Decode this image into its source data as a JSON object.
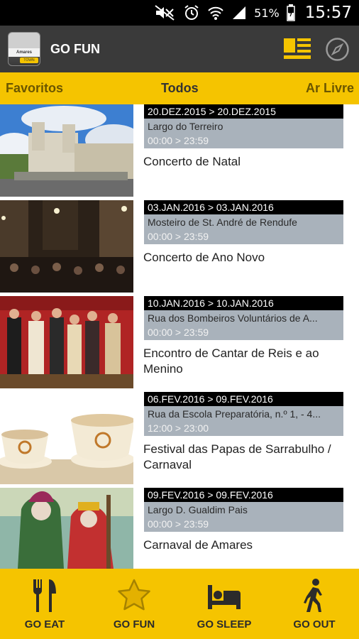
{
  "status_bar": {
    "battery": "51%",
    "time": "15:57"
  },
  "app_bar": {
    "title": "GO FUN",
    "logo_text": "Amares",
    "logo_badge": "TOWN"
  },
  "tabs": {
    "favorites": "Favoritos",
    "all": "Todos",
    "outdoor": "Ar Livre"
  },
  "events": [
    {
      "date": "20.DEZ.2015 > 20.DEZ.2015",
      "location": "Largo do Terreiro",
      "time": "00:00 > 23:59",
      "title": "Concerto de Natal"
    },
    {
      "date": "03.JAN.2016 > 03.JAN.2016",
      "location": "Mosteiro de St. André de Rendufe",
      "time": "00:00 > 23:59",
      "title": "Concerto de Ano Novo"
    },
    {
      "date": "10.JAN.2016 > 10.JAN.2016",
      "location": "Rua dos Bombeiros Voluntários de A...",
      "time": "00:00 > 23:59",
      "title": "Encontro de Cantar de Reis e ao Menino"
    },
    {
      "date": "06.FEV.2016 > 09.FEV.2016",
      "location": "Rua da Escola Preparatória, n.º 1, - 4...",
      "time": "12:00 > 23:00",
      "title": "Festival das Papas de Sarrabulho / Carnaval"
    },
    {
      "date": "09.FEV.2016 > 09.FEV.2016",
      "location": "Largo D. Gualdim Pais",
      "time": "00:00 > 23:59",
      "title": "Carnaval de Amares"
    }
  ],
  "bottom_nav": {
    "eat": "GO EAT",
    "fun": "GO FUN",
    "sleep": "GO SLEEP",
    "out": "GO OUT"
  },
  "colors": {
    "accent": "#f5c400",
    "app_bar": "#3a3a3a",
    "date_bar": "#000000",
    "location_box": "#a9b2bb"
  }
}
